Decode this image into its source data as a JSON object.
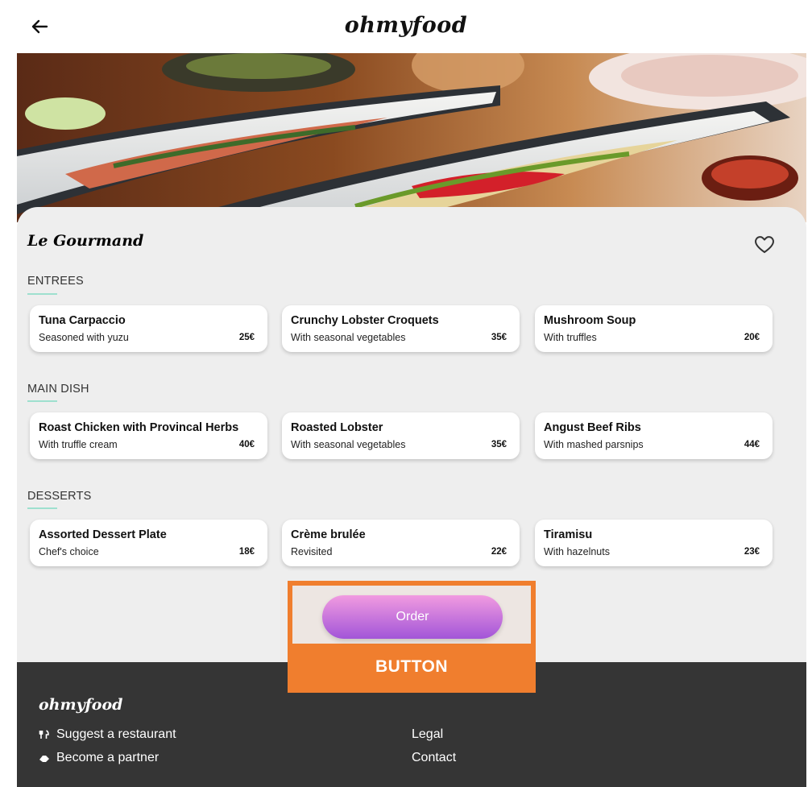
{
  "header": {
    "brand": "ohmyfood"
  },
  "restaurant": {
    "name": "Le Gourmand"
  },
  "sections": [
    {
      "title": "ENTREES",
      "dishes": [
        {
          "name": "Tuna Carpaccio",
          "description": "Seasoned with yuzu",
          "price": "25€"
        },
        {
          "name": "Crunchy Lobster Croquets",
          "description": "With seasonal vegetables",
          "price": "35€"
        },
        {
          "name": "Mushroom Soup",
          "description": "With truffles",
          "price": "20€"
        }
      ]
    },
    {
      "title": "MAIN DISH",
      "dishes": [
        {
          "name": "Roast Chicken with Provincal Herbs",
          "description": "With truffle cream",
          "price": "40€"
        },
        {
          "name": "Roasted Lobster",
          "description": "With seasonal vegetables",
          "price": "35€"
        },
        {
          "name": "Angust Beef Ribs",
          "description": "With mashed parsnips",
          "price": "44€"
        }
      ]
    },
    {
      "title": "DESSERTS",
      "dishes": [
        {
          "name": "Assorted Dessert Plate",
          "description": "Chef's choice",
          "price": "18€"
        },
        {
          "name": "Crème brulée",
          "description": "Revisited",
          "price": "22€"
        },
        {
          "name": "Tiramisu",
          "description": "With hazelnuts",
          "price": "23€"
        }
      ]
    }
  ],
  "order": {
    "label": "Order",
    "annotation": "BUTTON"
  },
  "footer": {
    "brand": "ohmyfood",
    "suggest": "Suggest a restaurant",
    "partner": "Become a partner",
    "legal": "Legal",
    "contact": "Contact"
  },
  "icons": {
    "back": "arrow-left-icon",
    "favorite": "heart-outline-icon",
    "suggest": "utensils-icon",
    "partner": "handshake-icon"
  },
  "colors": {
    "accent_underline": "#9ee0cf",
    "order_gradient_top": "#f19be0",
    "order_gradient_bottom": "#a255d8",
    "annotation": "#f07e2e",
    "footer_bg": "#353535",
    "panel_bg": "#eeeeee"
  }
}
